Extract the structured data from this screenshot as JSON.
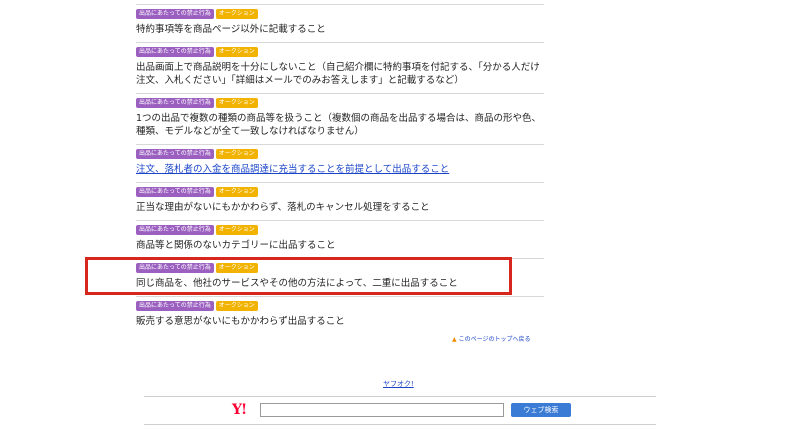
{
  "tags": {
    "prohibited": "出品にあたっての禁止行為",
    "option": "オークション"
  },
  "items": [
    {
      "text": "特約事項等を商品ページ以外に記載すること",
      "link": false
    },
    {
      "text": "出品画面上で商品説明を十分にしないこと（自己紹介欄に特約事項を付記する、「分かる人だけ注文、入札ください」「詳細はメールでのみお答えします」と記載するなど）",
      "link": false
    },
    {
      "text": "1つの出品で複数の種類の商品等を扱うこと（複数個の商品を出品する場合は、商品の形や色、種類、モデルなどが全て一致しなければなりません）",
      "link": false
    },
    {
      "text": "注文、落札者の入金を商品調達に充当することを前提として出品すること",
      "link": true
    },
    {
      "text": "正当な理由がないにもかかわらず、落札のキャンセル処理をすること",
      "link": false
    },
    {
      "text": "商品等と関係のないカテゴリーに出品すること",
      "link": false
    },
    {
      "text": "同じ商品を、他社のサービスやその他の方法によって、二重に出品すること",
      "link": false
    },
    {
      "text": "販売する意思がないにもかかわらず出品すること",
      "link": false
    }
  ],
  "page_top_link": "このページのトップへ戻る",
  "footer": {
    "brand_link": "ヤフオク!",
    "logo": "Y!",
    "search_placeholder": "",
    "search_button": "ウェブ検索"
  }
}
